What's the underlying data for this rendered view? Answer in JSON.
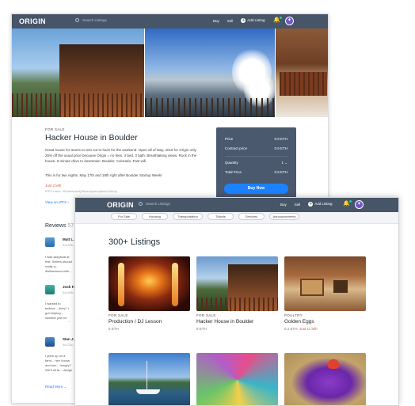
{
  "brand": {
    "logo": "ORIGIN"
  },
  "nav": {
    "search_placeholder": "Search Listings",
    "buy": "Buy",
    "sell": "Sell",
    "add_listing": "Add Listing"
  },
  "listing": {
    "category": "FOR SALE",
    "title": "Hacker House in Boulder",
    "description": "Great house for teams to rent out to hack for the weekend. Open all of May, 2019 for Origin only. 25% off the usual price because Origin = no fees. 4 bed, 3 bath. Breathtaking views. Rock in the house. 8 minute drive to downtown. Boulder, Colorado. Fast wifi.",
    "note": "This is for two nights. May 17th and 18th right after Boulder Startup Week!",
    "left_label": "Just 2 left!",
    "ipfs": "IPFS Hash: Ht1ktbwcse4j9fwlzdnjoeuqhtmbr13ktnp",
    "view_on_ipfs": "View on IPFS"
  },
  "price_card": {
    "price_label": "Price",
    "price_value": "0.9 ETH",
    "contract_label": "Contract price",
    "contract_value": "0.9 ETH",
    "quantity_label": "Quantity",
    "quantity_value": "1",
    "total_label": "Total Price",
    "total_value": "0.9 ETH",
    "buy_now": "Buy Now"
  },
  "reviews": {
    "heading": "Reviews",
    "count": "57",
    "items": [
      {
        "name": "Matt L.",
        "addr": "0x123b...",
        "text": "I was skeptical at first. Sellers should really q... disillusioned with..."
      },
      {
        "name": "Josh F.",
        "addr": "0x1a2b...",
        "text": "I wanted to believe... itchy? I got helping... sweater just for one... you agree? Nice la..."
      },
      {
        "name": "Stan J.",
        "addr": "0x123c...",
        "text": "I grew up on a farm... hen house and wer... hungry? We'll all fa... design selection f..."
      }
    ],
    "read_more": "Read More"
  },
  "categories": [
    "For Sale",
    "Housing",
    "Transportation",
    "Tickets",
    "Services",
    "Announcements"
  ],
  "listings": {
    "heading": "300+ Listings",
    "cards": [
      {
        "category": "FOR SALE",
        "title": "Production / DJ Lesson",
        "price": "5 ETH",
        "extra": ""
      },
      {
        "category": "FOR SALE",
        "title": "Hacker House in Boulder",
        "price": "9 ETH",
        "extra": ""
      },
      {
        "category": "POULTRY",
        "title": "Golden Eggs",
        "price": "0.2 ETH",
        "extra": "Just 11 left!"
      }
    ]
  },
  "colors": {
    "nav": "#465568",
    "accent": "#1a82ff",
    "alert": "#e5533d"
  }
}
